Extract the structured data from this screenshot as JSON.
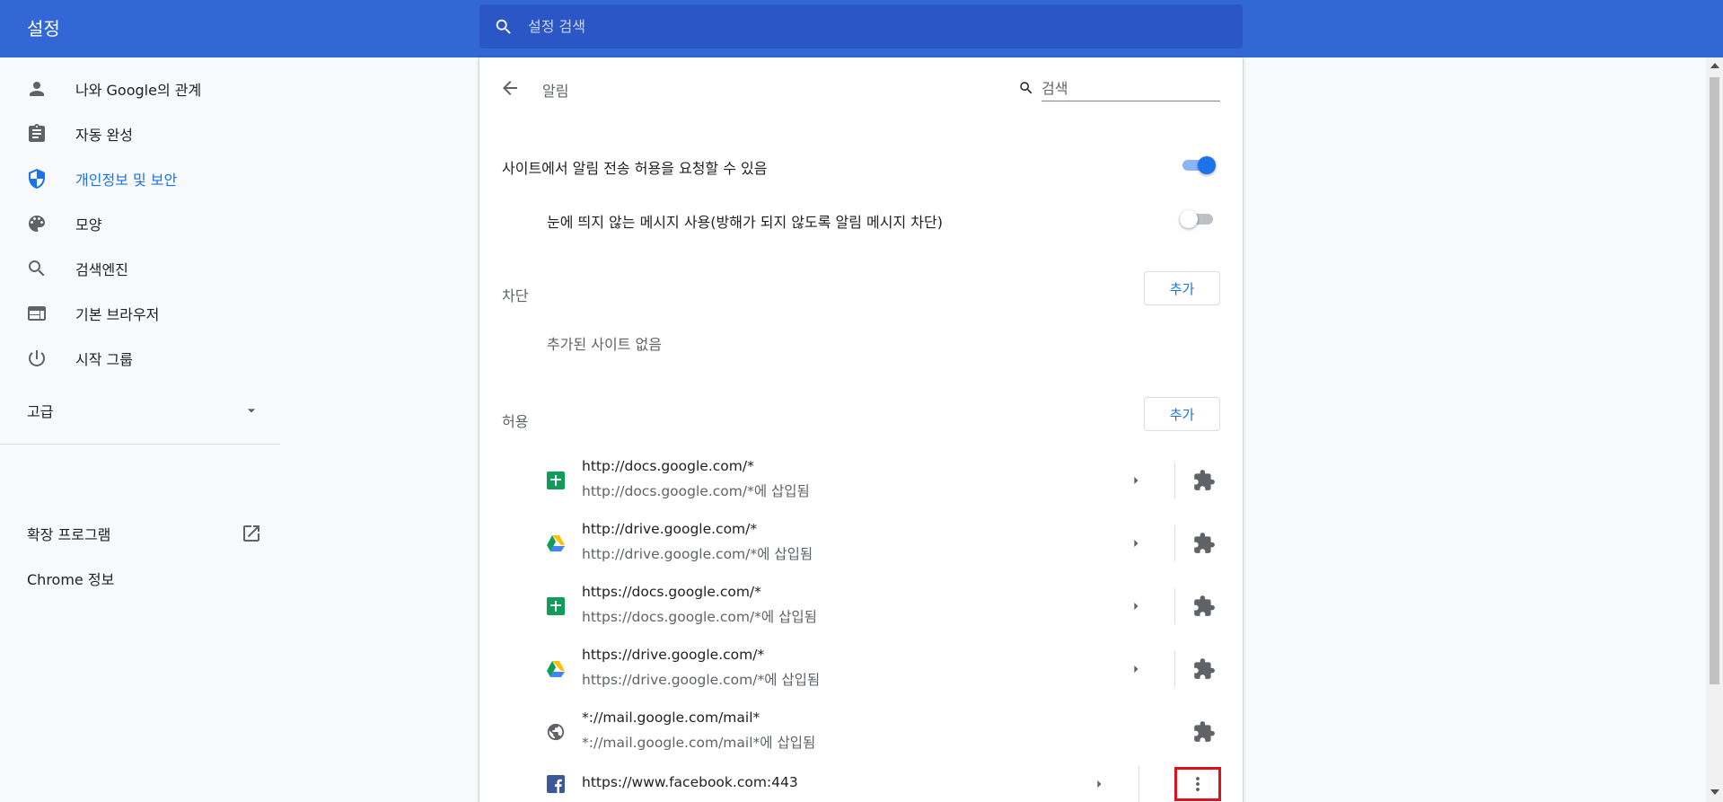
{
  "header": {
    "title": "설정",
    "search_placeholder": "설정 검색"
  },
  "sidebar": {
    "items": [
      {
        "label": "나와 Google의 관계",
        "icon": "person-icon",
        "active": false
      },
      {
        "label": "자동 완성",
        "icon": "clipboard-icon",
        "active": false
      },
      {
        "label": "개인정보 및 보안",
        "icon": "shield-icon",
        "active": true
      },
      {
        "label": "모양",
        "icon": "palette-icon",
        "active": false
      },
      {
        "label": "검색엔진",
        "icon": "search-icon",
        "active": false
      },
      {
        "label": "기본 브라우저",
        "icon": "browser-icon",
        "active": false
      },
      {
        "label": "시작 그룹",
        "icon": "power-icon",
        "active": false
      }
    ],
    "advanced_label": "고급",
    "extensions_label": "확장 프로그램",
    "about_label": "Chrome 정보"
  },
  "main": {
    "page_title": "알림",
    "search_placeholder": "검색",
    "ask_toggle_label": "사이트에서 알림 전송 허용을 요청할 수 있음",
    "ask_toggle_on": true,
    "quiet_toggle_label": "눈에 띄지 않는 메시지 사용(방해가 되지 않도록 알림 메시지 차단)",
    "quiet_toggle_on": false,
    "block_section": {
      "label": "차단",
      "add_label": "추가",
      "empty_text": "추가된 사이트 없음"
    },
    "allow_section": {
      "label": "허용",
      "add_label": "추가",
      "sites": [
        {
          "url": "http://docs.google.com/*",
          "sub": "http://docs.google.com/*에 삽입됨",
          "favicon": "sheets-icon"
        },
        {
          "url": "http://drive.google.com/*",
          "sub": "http://drive.google.com/*에 삽입됨",
          "favicon": "drive-icon"
        },
        {
          "url": "https://docs.google.com/*",
          "sub": "https://docs.google.com/*에 삽입됨",
          "favicon": "sheets-icon"
        },
        {
          "url": "https://drive.google.com/*",
          "sub": "https://drive.google.com/*에 삽입됨",
          "favicon": "drive-icon"
        },
        {
          "url": "*://mail.google.com/mail*",
          "sub": "*://mail.google.com/mail*에 삽입됨",
          "favicon": "globe-icon"
        },
        {
          "url": "https://www.facebook.com:443",
          "sub": "",
          "favicon": "facebook-icon"
        }
      ]
    }
  },
  "colors": {
    "header_bg": "#3367d6",
    "search_bg": "#2a56c6",
    "accent": "#1a73e8",
    "highlight_border": "#e0101e"
  }
}
